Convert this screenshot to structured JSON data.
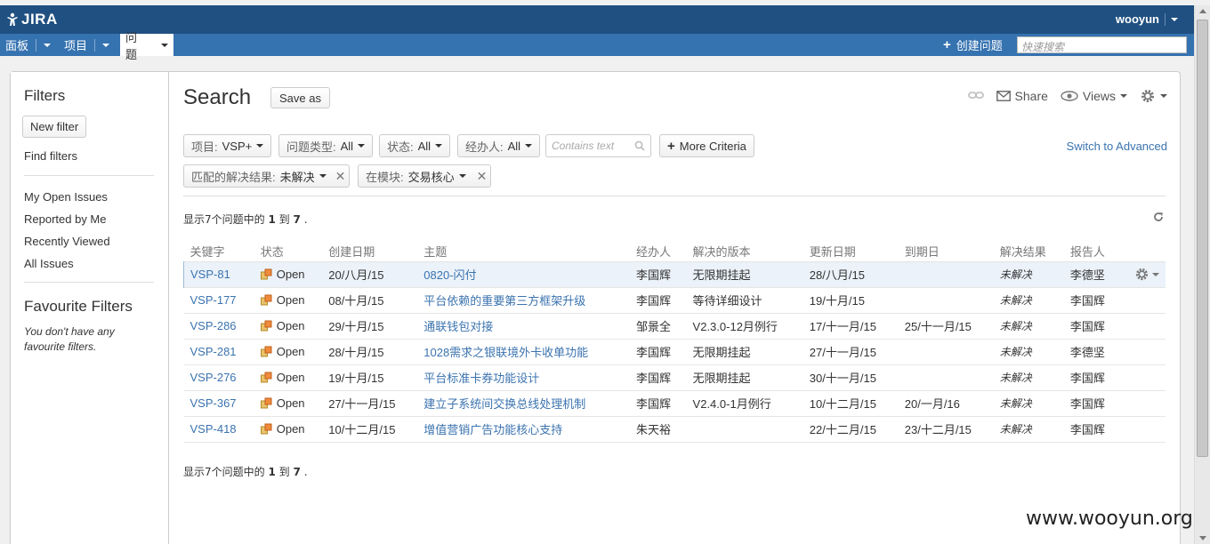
{
  "header": {
    "logo_text": "JIRA",
    "user": "wooyun"
  },
  "nav": {
    "items": [
      {
        "label": "面板"
      },
      {
        "label": "项目"
      },
      {
        "label": "问题"
      }
    ],
    "create_label": "创建问题",
    "quick_search_placeholder": "快速搜索"
  },
  "sidebar": {
    "filters_title": "Filters",
    "new_filter": "New filter",
    "find_filters": "Find filters",
    "links": [
      "My Open Issues",
      "Reported by Me",
      "Recently Viewed",
      "All Issues"
    ],
    "favourite_title": "Favourite Filters",
    "favourite_empty": "You don't have any favourite filters."
  },
  "search": {
    "title": "Search",
    "save_as": "Save as",
    "share": "Share",
    "views": "Views",
    "criteria": [
      {
        "key": "项目:",
        "value": "VSP+"
      },
      {
        "key": "问题类型:",
        "value": "All"
      },
      {
        "key": "状态:",
        "value": "All"
      },
      {
        "key": "经办人:",
        "value": "All"
      }
    ],
    "text_placeholder": "Contains text",
    "more_criteria": "More Criteria",
    "switch_advanced": "Switch to Advanced",
    "extra_criteria": [
      {
        "key": "匹配的解决结果:",
        "value": "未解决"
      },
      {
        "key": "在模块:",
        "value": "交易核心"
      }
    ],
    "count_prefix": "显示7个问题中的",
    "count_from": "1",
    "count_to_word": "到",
    "count_to": "7",
    "count_suffix": "."
  },
  "table": {
    "columns": [
      "关键字",
      "状态",
      "创建日期",
      "主题",
      "经办人",
      "解决的版本",
      "更新日期",
      "到期日",
      "解决结果",
      "报告人"
    ],
    "rows": [
      {
        "key": "VSP-81",
        "status": "Open",
        "created": "20/八月/15",
        "summary": "0820-闪付",
        "assignee": "李国辉",
        "fix_version": "无限期挂起",
        "updated": "28/八月/15",
        "due": "",
        "resolution": "未解决",
        "reporter": "李德坚"
      },
      {
        "key": "VSP-177",
        "status": "Open",
        "created": "08/十月/15",
        "summary": "平台依赖的重要第三方框架升级",
        "assignee": "李国辉",
        "fix_version": "等待详细设计",
        "updated": "19/十月/15",
        "due": "",
        "resolution": "未解决",
        "reporter": "李国辉"
      },
      {
        "key": "VSP-286",
        "status": "Open",
        "created": "29/十月/15",
        "summary": "通联钱包对接",
        "assignee": "邹景全",
        "fix_version": "V2.3.0-12月例行",
        "updated": "17/十一月/15",
        "due": "25/十一月/15",
        "resolution": "未解决",
        "reporter": "李国辉"
      },
      {
        "key": "VSP-281",
        "status": "Open",
        "created": "28/十月/15",
        "summary": "1028需求之银联境外卡收单功能",
        "assignee": "李国辉",
        "fix_version": "无限期挂起",
        "updated": "27/十一月/15",
        "due": "",
        "resolution": "未解决",
        "reporter": "李德坚"
      },
      {
        "key": "VSP-276",
        "status": "Open",
        "created": "19/十月/15",
        "summary": "平台标准卡券功能设计",
        "assignee": "李国辉",
        "fix_version": "无限期挂起",
        "updated": "30/十一月/15",
        "due": "",
        "resolution": "未解决",
        "reporter": "李国辉"
      },
      {
        "key": "VSP-367",
        "status": "Open",
        "created": "27/十一月/15",
        "summary": "建立子系统间交换总线处理机制",
        "assignee": "李国辉",
        "fix_version": "V2.4.0-1月例行",
        "updated": "10/十二月/15",
        "due": "20/一月/16",
        "resolution": "未解决",
        "reporter": "李国辉"
      },
      {
        "key": "VSP-418",
        "status": "Open",
        "created": "10/十二月/15",
        "summary": "增值营销广告功能核心支持",
        "assignee": "朱天裕",
        "fix_version": "",
        "updated": "22/十二月/15",
        "due": "23/十二月/15",
        "resolution": "未解决",
        "reporter": "李国辉"
      }
    ]
  },
  "watermark": "www.wooyun.org"
}
